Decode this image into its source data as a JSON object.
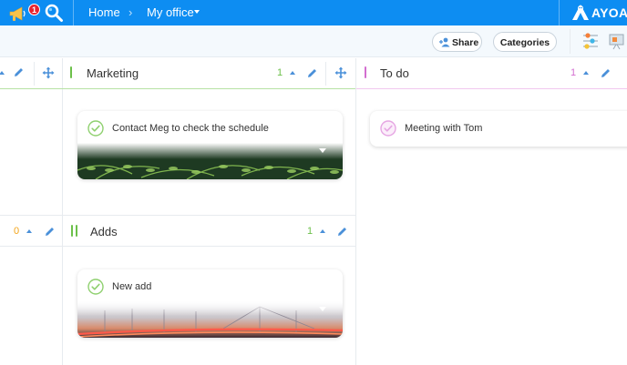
{
  "topbar": {
    "notification_count": "1",
    "breadcrumb": {
      "home": "Home",
      "separator": "›",
      "current": "My office"
    },
    "logo_text": "AYOA"
  },
  "toolbar": {
    "share_label": "Share",
    "categories_label": "Categories"
  },
  "board": {
    "columns": [
      {
        "title": "Marketing",
        "count": "1",
        "accent_color": "#6cc04a"
      },
      {
        "title": "To do",
        "count": "1",
        "accent_color": "#d36ed0"
      },
      {
        "title": "Adds",
        "count": "1",
        "accent_color": "#6cc04a"
      }
    ],
    "left_partial_count": "0",
    "cards": [
      {
        "title": "Contact Meg to check the schedule",
        "image": "fern-leaves"
      },
      {
        "title": "Meeting with Tom"
      },
      {
        "title": "New add",
        "image": "bridge-sunset"
      }
    ]
  },
  "colors": {
    "brand_blue": "#0d8df2",
    "count_green": "#6cc04a",
    "count_pink": "#d36ed0",
    "count_orange": "#f3a41a",
    "icon_blue": "#4a90d9"
  }
}
